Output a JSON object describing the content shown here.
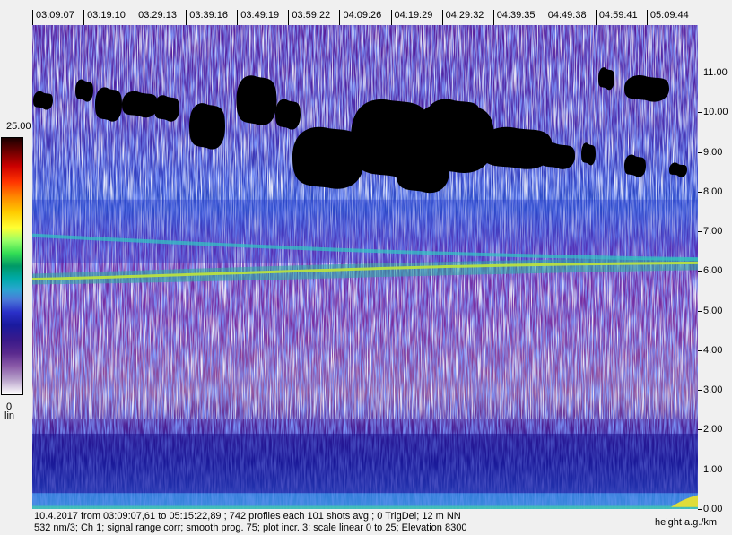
{
  "chart_data": {
    "type": "heatmap",
    "x_tick_labels": [
      "03:09:07",
      "03:19:10",
      "03:29:13",
      "03:39:16",
      "03:49:19",
      "03:59:22",
      "04:09:26",
      "04:19:29",
      "04:29:32",
      "04:39:35",
      "04:49:38",
      "04:59:41",
      "05:09:44"
    ],
    "y_tick_labels": [
      "0.00",
      "1.00",
      "2.00",
      "3.00",
      "4.00",
      "5.00",
      "6.00",
      "7.00",
      "8.00",
      "9.00",
      "10.00",
      "11.00"
    ],
    "y_unit_label": "height a.g./km",
    "ylim": [
      0,
      12.2
    ],
    "colorbar": {
      "max_label": "25.00",
      "min_label": "0",
      "unit": "lin",
      "range": [
        0,
        25
      ]
    },
    "features": {
      "cirrus_cloud_base_km": 8.0,
      "cirrus_cloud_top_km": 10.8,
      "aerosol_layer_km": 5.8,
      "boundary_layer_top_km": 1.9
    },
    "footer_line1": "10.4.2017 from 03:09:07,61 to 05:15:22,89 ; 742 profiles  each 101 shots avg.; 0 TrigDel; 12 m NN",
    "footer_line2": "532 nm/3; Ch 1;  signal range corr; smooth prog. 75; plot incr. 3; scale linear 0 to 25; Elevation 8300"
  }
}
